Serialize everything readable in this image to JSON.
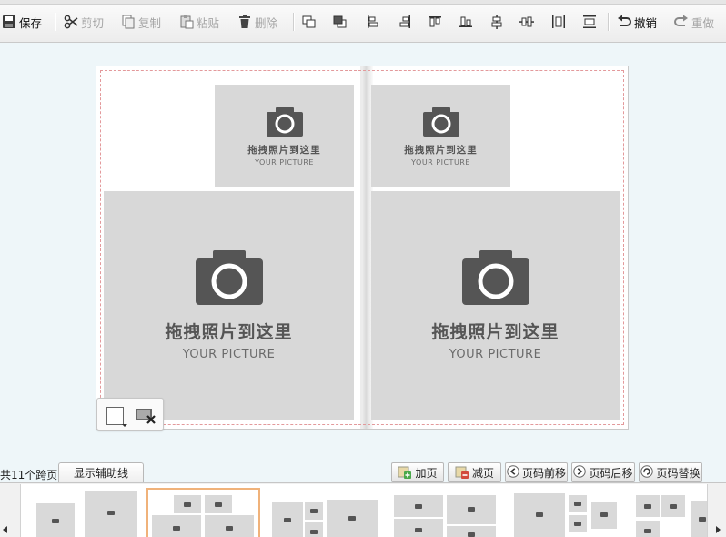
{
  "toolbar": {
    "save": "保存",
    "cut": "剪切",
    "copy": "复制",
    "paste": "粘贴",
    "delete": "删除",
    "undo": "撤销",
    "redo": "重做"
  },
  "canvas": {
    "placeholder_cn": "拖拽照片到这里",
    "placeholder_en": "YOUR PICTURE"
  },
  "pages": {
    "total_text": "共11个跨页",
    "show_guides": "显示辅助线",
    "add_page": "加页",
    "remove_page": "减页",
    "move_forward": "页码前移",
    "move_backward": "页码后移",
    "replace_page": "页码替换"
  },
  "colors": {
    "guide": "#e3999b",
    "selected_thumb": "#f0b27a",
    "photo_slot": "#d8d8d8",
    "background": "#eef6f9"
  },
  "icons": [
    "save-icon",
    "cut-icon",
    "copy-icon",
    "paste-icon",
    "delete-icon",
    "align-icons",
    "undo-icon",
    "redo-icon",
    "camera-icon",
    "add-page-icon",
    "remove-page-icon",
    "arrow-left-icon",
    "arrow-right-icon",
    "replace-icon"
  ]
}
